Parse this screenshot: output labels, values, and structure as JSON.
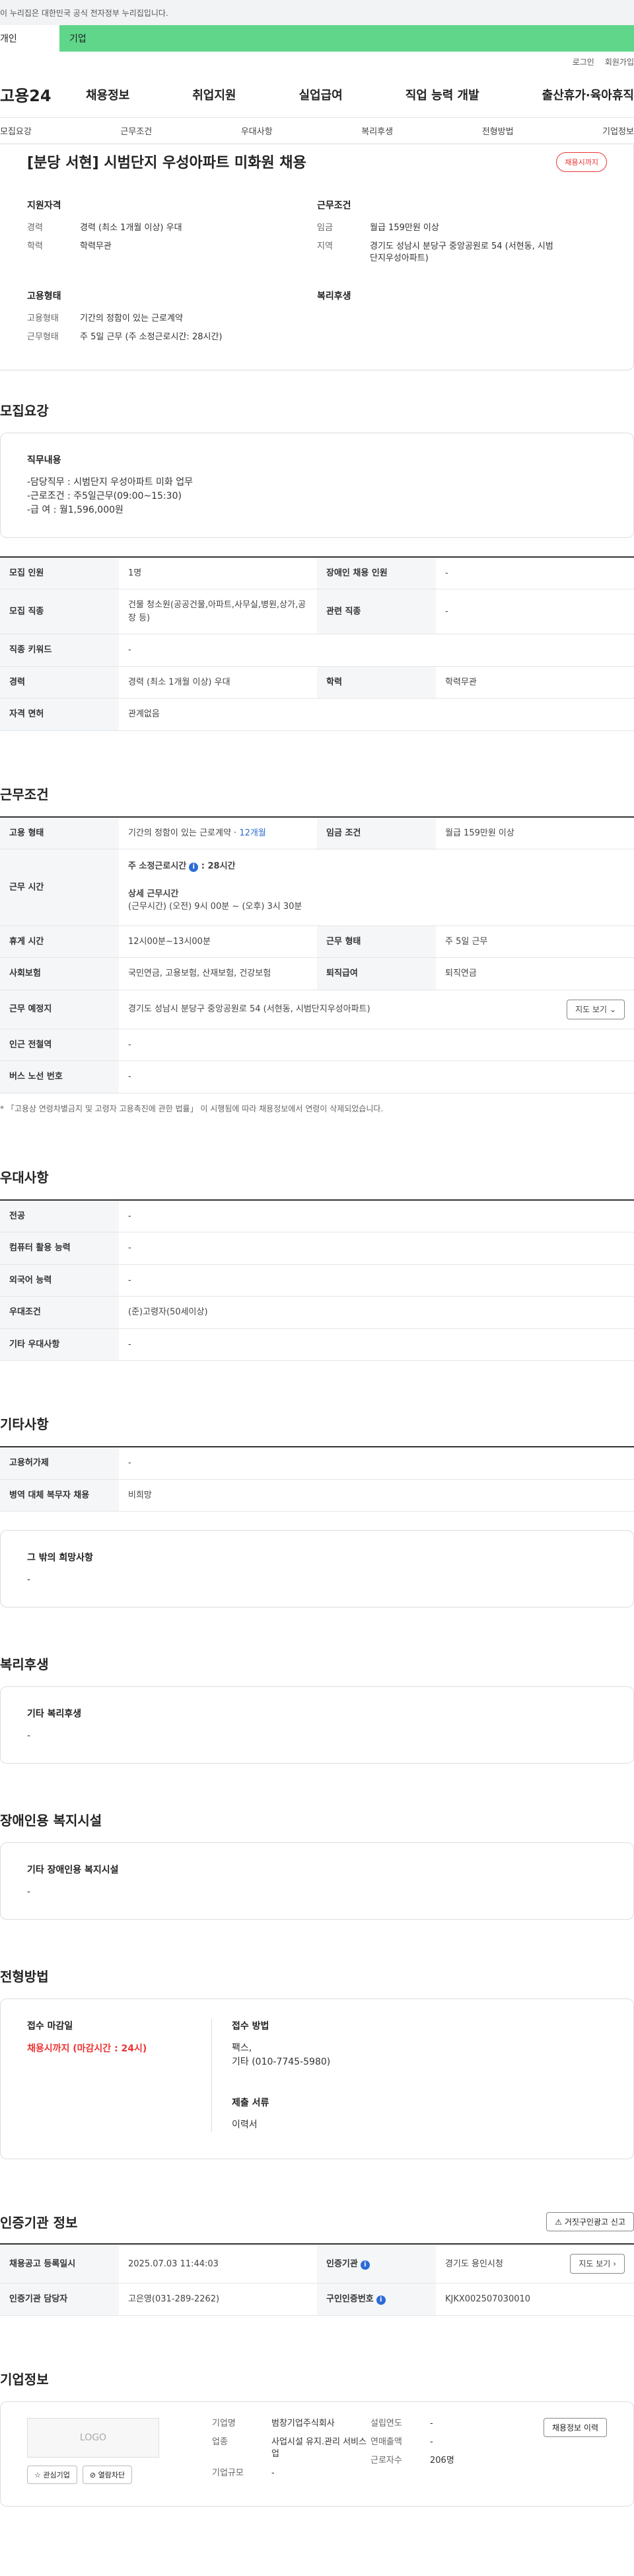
{
  "topbar": {
    "notice": "이 누리집은 대한민국 공식 전자정부 누리집입니다."
  },
  "usertabs": [
    "개인",
    "기업"
  ],
  "util": {
    "login": "로그인",
    "signup": "회원가입"
  },
  "gnb": {
    "logo": "고용24",
    "menu": [
      "채용정보",
      "취업지원",
      "실업급여",
      "직업 능력 개발",
      "출산휴가·육아휴직"
    ]
  },
  "subnav": [
    "모집요강",
    "근무조건",
    "우대사항",
    "복리후생",
    "전형방법",
    "기업정보"
  ],
  "job": {
    "title": "[분당 서현] 시범단지 우성아파트 미화원 채용",
    "badge": "채용시까지",
    "apply_h": "지원자격",
    "apply": [
      {
        "k": "경력",
        "v": "경력 (최소 1개월 이상) 우대"
      },
      {
        "k": "학력",
        "v": "학력무관"
      }
    ],
    "cond_h": "근무조건",
    "cond": [
      {
        "k": "임금",
        "v": "월급 159만원 이상"
      },
      {
        "k": "지역",
        "v": "경기도 성남시 분당구 중앙공원로 54 (서현동, 시범단지우성아파트)"
      }
    ],
    "emp_h": "고용형태",
    "emp": [
      {
        "k": "고용형태",
        "v": "기간의 정함이 있는 근로계약"
      },
      {
        "k": "근무형태",
        "v": "주 5일 근무 (주 소정근로시간: 28시간)"
      }
    ],
    "welfare_h": "복리후생"
  },
  "recruit": {
    "title": "모집요강",
    "duty_h": "직무내용",
    "duty": "-담당직무 : 시범단지 우성아파트 미화 업무\n-근로조건 : 주5일근무(09:00~15:30)\n-급      여 : 월1,596,000원",
    "rows": [
      [
        "모집 인원",
        "1명",
        "장애인 채용 인원",
        "-"
      ],
      [
        "모집 직종",
        "건물 청소원(공공건물,아파트,사무실,병원,상가,공장 등)",
        "관련 직종",
        "-"
      ],
      [
        "직종 키워드",
        "-"
      ],
      [
        "경력",
        "경력 (최소 1개월 이상) 우대",
        "학력",
        "학력무관"
      ],
      [
        "자격 면허",
        "관계없음"
      ]
    ]
  },
  "work": {
    "title": "근무조건",
    "emp_type_k": "고용 형태",
    "emp_type_v": "기간의 정함이 있는 근로계약 · ",
    "emp_type_period": "12개월",
    "wage_k": "임금 조건",
    "wage_v": "월급 159만원 이상",
    "hours_k": "근무 시간",
    "hours_main": "주 소정근로시간",
    "hours_main_v": ": 28시간",
    "hours_detail_h": "상세 근무시간",
    "hours_detail": "(근무시간) (오전) 9시 00분 ~ (오후) 3시 30분",
    "break_k": "휴게 시간",
    "break_v": "12시00분~13시00분",
    "form_k": "근무 형태",
    "form_v": "주 5일 근무",
    "ins_k": "사회보험",
    "ins_v": "국민연금, 고용보험, 산재보험, 건강보험",
    "retire_k": "퇴직급여",
    "retire_v": "퇴직연금",
    "place_k": "근무 예정지",
    "place_v": "경기도 성남시 분당구 중앙공원로 54 (서현동, 시범단지우성아파트)",
    "map_btn": "지도 보기",
    "subway_k": "인근 전철역",
    "subway_v": "-",
    "bus_k": "버스 노선 번호",
    "bus_v": "-",
    "note": "「고용상 연령차별금지 및 고령자 고용촉진에 관한 법률」 이 시행됨에 따라 채용정보에서 연령이 삭제되었습니다."
  },
  "pref": {
    "title": "우대사항",
    "rows": [
      [
        "전공",
        "-"
      ],
      [
        "컴퓨터 활용 능력",
        "-"
      ],
      [
        "외국어 능력",
        "-"
      ],
      [
        "우대조건",
        "(준)고령자(50세이상)"
      ],
      [
        "기타 우대사항",
        "-"
      ]
    ]
  },
  "etc": {
    "title": "기타사항",
    "rows": [
      [
        "고용허가제",
        "-"
      ],
      [
        "병역 대체 복무자 채용",
        "비희망"
      ]
    ],
    "other_h": "그 밖의 희망사항",
    "other_v": "-"
  },
  "welfare": {
    "title": "복리후생",
    "h": "기타 복리후생",
    "v": "-"
  },
  "disab": {
    "title": "장애인용 복지시설",
    "h": "기타 장애인용 복지시설",
    "v": "-"
  },
  "select": {
    "title": "전형방법",
    "deadline_h": "접수 마감일",
    "deadline_v": "채용시까지 (마감시간 : 24시)",
    "method_h": "접수 방법",
    "method_v": "팩스,\n기타 (010-7745-5980)",
    "docs_h": "제출 서류",
    "docs_v": "이력서"
  },
  "cert": {
    "title": "인증기관 정보",
    "report_btn": "거짓구인광고 신고",
    "reg_k": "채용공고 등록일시",
    "reg_v": "2025.07.03 11:44:03",
    "org_k": "인증기관",
    "org_v": "경기도 용인시청",
    "map_btn": "지도 보기",
    "mgr_k": "인증기관 담당자",
    "mgr_v": "고은영(031-289-2262)",
    "num_k": "구인인증번호",
    "num_v": "KJKX002507030010"
  },
  "company": {
    "title": "기업정보",
    "logo": "LOGO",
    "interest_btn": "관심기업",
    "block_btn": "열람차단",
    "name_k": "기업명",
    "name_v": "범창기업주식회사",
    "type_k": "업종",
    "type_v": "사업시설 유지.관리 서비스업",
    "size_k": "기업규모",
    "size_v": "-",
    "found_k": "설립연도",
    "found_v": "-",
    "sales_k": "연매출액",
    "sales_v": "-",
    "emp_k": "근로자수",
    "emp_v": "206명",
    "history_btn": "채용정보 이력"
  }
}
